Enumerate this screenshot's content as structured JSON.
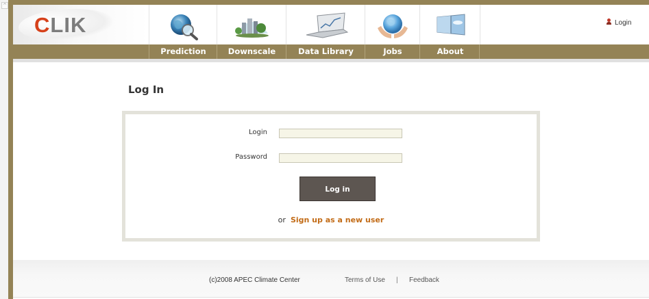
{
  "header": {
    "logo_c": "C",
    "logo_rest": "LIK",
    "login_link": "Login"
  },
  "nav": {
    "items": [
      {
        "label": "Prediction",
        "icon": "globe-magnifier-icon"
      },
      {
        "label": "Downscale",
        "icon": "city-globe-icon"
      },
      {
        "label": "Data Library",
        "icon": "laptop-chart-icon"
      },
      {
        "label": "Jobs",
        "icon": "globe-in-hands-icon"
      },
      {
        "label": "About",
        "icon": "window-sky-icon"
      }
    ]
  },
  "main": {
    "title": "Log In",
    "form": {
      "login_label": "Login",
      "login_value": "",
      "password_label": "Password",
      "password_value": "",
      "submit_label": "Log in",
      "signup_prefix": "or",
      "signup_link": "Sign up as a new user"
    }
  },
  "footer": {
    "copyright": "(c)2008 APEC Climate Center",
    "terms": "Terms of Use",
    "separator": "|",
    "feedback": "Feedback"
  },
  "colors": {
    "accent_bar": "#948356",
    "button": "#5d5651",
    "signup_link": "#c26b16",
    "logo_c": "#d6411b"
  }
}
